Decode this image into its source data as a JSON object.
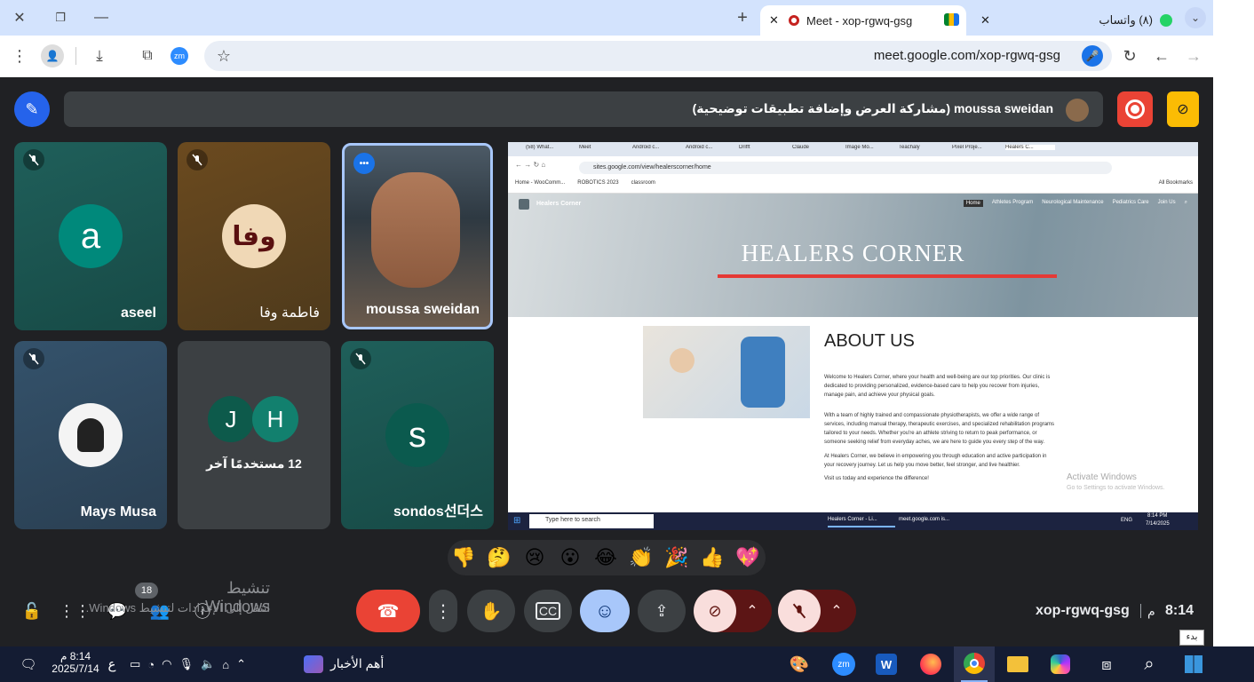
{
  "browser": {
    "tabs": [
      {
        "title": "Meet - xop-rgwq-gsg",
        "active": true
      },
      {
        "title": "(٨) واتساب",
        "active": false
      }
    ],
    "url": "meet.google.com/xop-rgwq-gsg",
    "zoom_ext_label": "zm"
  },
  "meet": {
    "presenter_banner": "moussa sweidan (مشاركة العرض وإضافة تطبيقات توضيحية)",
    "participants": [
      {
        "name": "aseel",
        "initial": "a",
        "avatar_color": "#00897b",
        "muted": true
      },
      {
        "name": "فاطمة وفا",
        "avatar_text": "وفا",
        "muted": true
      },
      {
        "name": "moussa sweidan",
        "speaking": true
      },
      {
        "name": "Mays Musa",
        "muted": true
      },
      {
        "name": "12 مستخدمًا آخر",
        "initials": [
          "J",
          "H"
        ]
      },
      {
        "name": "sondos선더스",
        "initial": "s",
        "avatar_color": "#0b5a4e",
        "muted": true
      }
    ],
    "reactions": [
      "👎",
      "🤔",
      "😢",
      "😮",
      "😂",
      "👏",
      "🎉",
      "👍",
      "💖"
    ],
    "meeting_code": "xop-rgwq-gsg",
    "time": "8:14",
    "time_suffix": "م",
    "participant_count": "18",
    "watermark_title": "تنشيط Windows",
    "watermark_sub": "انتقل إلى الإعدادات لتنشيط Windows."
  },
  "shared_screen": {
    "tabs": [
      "(58) What...",
      "Meet",
      "Android c...",
      "Android c...",
      "Drifft",
      "Claude",
      "Image Mo...",
      "Teachaly",
      "Pixel Proje...",
      "Healers C..."
    ],
    "url": "sites.google.com/view/healerscorner/home",
    "bookmarks": [
      "Home - WooComm...",
      "ROBOTICS 2023",
      "classroom"
    ],
    "all_bookmarks": "All Bookmarks",
    "site_name": "Healers Corner",
    "nav": [
      "Home",
      "Athletes Program",
      "Neurological Maintenance",
      "Pediatrics Care",
      "Join Us"
    ],
    "hero_title": "HEALERS CORNER",
    "about_title": "ABOUT US",
    "about_paragraphs": [
      "Welcome to Healers Corner, where your health and well-being are our top priorities. Our clinic is dedicated to providing personalized, evidence-based care to help you recover from injuries, manage pain, and achieve your physical goals.",
      "With a team of highly trained and compassionate physiotherapists, we offer a wide range of services, including manual therapy, therapeutic exercises, and specialized rehabilitation programs tailored to your needs. Whether you're an athlete striving to return to peak performance, or someone seeking relief from everyday aches, we are here to guide you every step of the way.",
      "At Healers Corner, we believe in empowering you through education and active participation in your recovery journey. Let us help you move better, feel stronger, and live healthier.",
      "Visit us today and experience the difference!"
    ],
    "activate_title": "Activate Windows",
    "activate_sub": "Go to Settings to activate Windows.",
    "search_placeholder": "Type here to search",
    "task_items": [
      "Healers Corner - Li...",
      "meet.google.com is..."
    ],
    "clock_time": "8:14 PM",
    "clock_date": "7/14/2025",
    "lang": "ENG"
  },
  "taskbar": {
    "news": "أهم الأخبار",
    "time": "8:14 م",
    "date": "2025/7/14",
    "lang": "ع",
    "start_tooltip": "بدء"
  }
}
